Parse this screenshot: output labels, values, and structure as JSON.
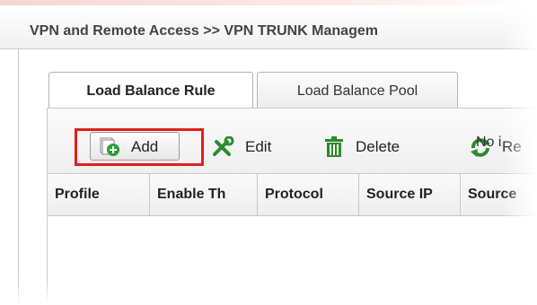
{
  "breadcrumb": {
    "text": "VPN and Remote Access >> VPN TRUNK Managem"
  },
  "tabs": [
    {
      "label": "Load Balance Rule",
      "active": true
    },
    {
      "label": "Load Balance Pool",
      "active": false
    }
  ],
  "toolbar": {
    "add_label": "Add",
    "edit_label": "Edit",
    "delete_label": "Delete",
    "refresh_label": "Re"
  },
  "table": {
    "columns": [
      "Profile",
      "Enable Th",
      "Protocol",
      "Source IP",
      "Source"
    ],
    "empty_text": "No i"
  },
  "colors": {
    "highlight": "#e0201d",
    "add_icon": "#2c9d3a",
    "edit_icon": "#2a8d2e",
    "delete_icon": "#2b8a2a"
  }
}
